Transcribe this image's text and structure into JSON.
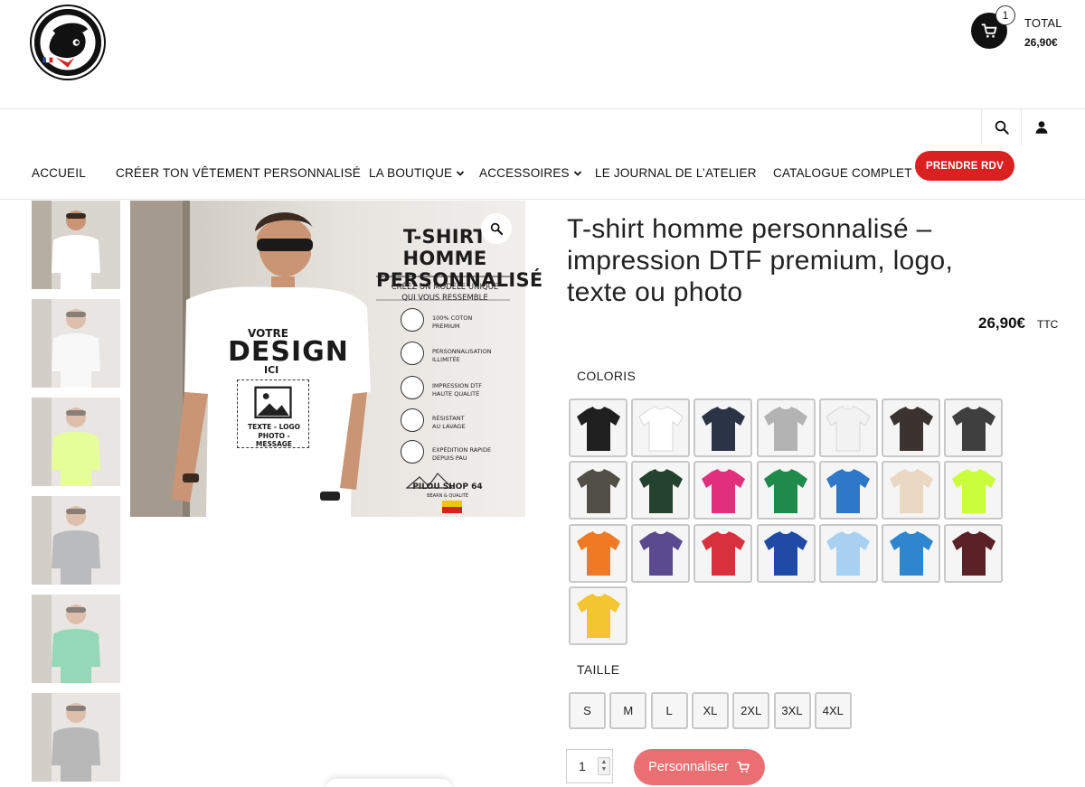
{
  "header": {
    "logo_name": "pilou-shop-logo",
    "cart": {
      "count": "1",
      "total_label": "TOTAL",
      "total_value": "26,90€"
    }
  },
  "nav": {
    "items": [
      {
        "label": "ACCUEIL",
        "dropdown": false
      },
      {
        "label": "CRÉER TON VÊTEMENT PERSONNALISÉ",
        "dropdown": false
      },
      {
        "label": "LA BOUTIQUE",
        "dropdown": true
      },
      {
        "label": "ACCESSOIRES",
        "dropdown": true
      },
      {
        "label": "LE JOURNAL DE L’ATELIER",
        "dropdown": false
      },
      {
        "label": "CATALOGUE COMPLET",
        "dropdown": false
      }
    ],
    "cta_label": "PRENDRE RDV"
  },
  "gallery": {
    "main_image": {
      "title_line1": "T-SHIRT HOMME",
      "title_line2": "PERSONNALISÉ",
      "subtitle_line1": "CRÉEZ UN MODÈLE UNIQUE",
      "subtitle_line2": "QUI VOUS RESSEMBLE",
      "features": [
        {
          "line1": "100% COTON",
          "line2": "PREMIUM"
        },
        {
          "line1": "PERSONNALISATION",
          "line2": "ILLIMITÉE"
        },
        {
          "line1": "IMPRESSION DTF",
          "line2": "HAUTE QUALITÉ"
        },
        {
          "line1": "RÉSISTANT",
          "line2": "AU LAVAGE"
        },
        {
          "line1": "EXPÉDITION RAPIDE",
          "line2": "DEPUIS PAU"
        }
      ],
      "brand": "PILOU SHOP 64",
      "brand_sub": "BÉARN & QUALITÉ",
      "tee_votre": "VOTRE",
      "tee_design": "DESIGN",
      "tee_ici": "ICI",
      "tee_line1": "TEXTE - LOGO",
      "tee_line2": "PHOTO - MESSAGE"
    },
    "thumbnails": [
      {
        "shirt_color": "#ffffff"
      },
      {
        "shirt_color": "#f4f4f4"
      },
      {
        "shirt_color": "#d8ff55"
      },
      {
        "shirt_color": "#8d8f94"
      },
      {
        "shirt_color": "#4fbf8a"
      },
      {
        "shirt_color": "#8a8a8a"
      }
    ]
  },
  "product": {
    "title": "T-shirt homme personnalisé – impression DTF premium, logo, texte ou photo",
    "price": "26,90€",
    "price_suffix": "TTC",
    "color_label": "COLORIS",
    "colors": [
      "#1f1f1f",
      "#ffffff",
      "#2b3445",
      "#b3b3b3",
      "#f2f2f2",
      "#3b3330",
      "#3f3f3f",
      "#525046",
      "#23432f",
      "#e0307d",
      "#1f8a4a",
      "#2f77c9",
      "#ead8c3",
      "#c8ff3a",
      "#f07a23",
      "#5b4a8f",
      "#d8303c",
      "#1f4aa6",
      "#a8d0f0",
      "#2e86cf",
      "#5a2226",
      "#f3c531"
    ],
    "size_label": "TAILLE",
    "sizes": [
      "S",
      "M",
      "L",
      "XL",
      "2XL",
      "3XL",
      "4XL"
    ],
    "quantity": "1",
    "customize_label": "Personnaliser"
  }
}
